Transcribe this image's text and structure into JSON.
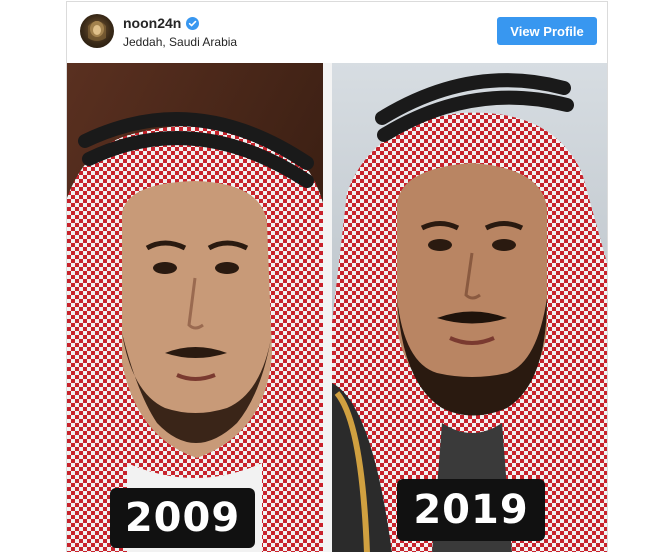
{
  "post": {
    "username": "noon24n",
    "location": "Jeddah, Saudi Arabia",
    "verified_icon": "verified-badge-icon",
    "view_profile_label": "View Profile",
    "accent_color": "#3897f0"
  },
  "photo": {
    "left_year": "2009",
    "right_year": "2019",
    "headscarf_colors": [
      "#c8232c",
      "#f2f2f2"
    ],
    "agal_color": "#1a1a1a"
  }
}
